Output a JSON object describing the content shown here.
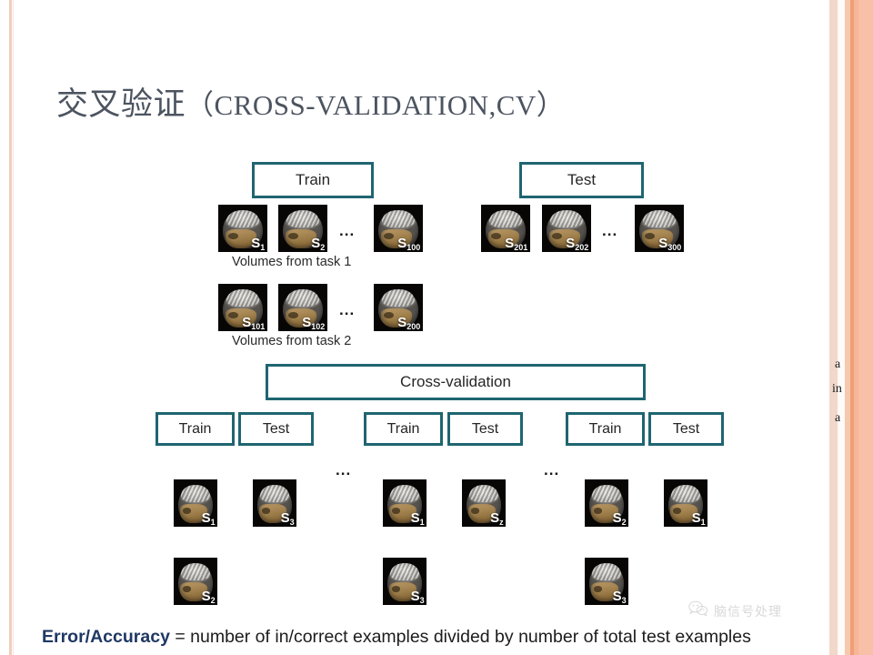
{
  "slide": {
    "title_cn": "交叉验证",
    "title_en": "（CROSS-VALIDATION,CV）"
  },
  "top_section": {
    "train_box": "Train",
    "test_box": "Test",
    "task1_caption": "Volumes from task 1",
    "task2_caption": "Volumes from task 2",
    "ellipsis": "...",
    "train_task1_brains": [
      {
        "label": "S",
        "sub": "1"
      },
      {
        "label": "S",
        "sub": "2"
      },
      {
        "label": "S",
        "sub": "100"
      }
    ],
    "test_brains": [
      {
        "label": "S",
        "sub": "201"
      },
      {
        "label": "S",
        "sub": "202"
      },
      {
        "label": "S",
        "sub": "300"
      }
    ],
    "task2_brains": [
      {
        "label": "S",
        "sub": "101"
      },
      {
        "label": "S",
        "sub": "102"
      },
      {
        "label": "S",
        "sub": "200"
      }
    ]
  },
  "cv_section": {
    "cv_box": "Cross-validation",
    "ellipsis": "...",
    "folds": [
      {
        "train_label": "Train",
        "test_label": "Test",
        "row1": [
          {
            "label": "S",
            "sub": "1"
          },
          {
            "label": "S",
            "sub": "3"
          }
        ],
        "row2": [
          {
            "label": "S",
            "sub": "2"
          }
        ]
      },
      {
        "train_label": "Train",
        "test_label": "Test",
        "row1": [
          {
            "label": "S",
            "sub": "1"
          },
          {
            "label": "S",
            "sub": "z"
          }
        ],
        "row2": [
          {
            "label": "S",
            "sub": "3"
          }
        ]
      },
      {
        "train_label": "Train",
        "test_label": "Test",
        "row1": [
          {
            "label": "S",
            "sub": "2"
          },
          {
            "label": "S",
            "sub": "1"
          }
        ],
        "row2": [
          {
            "label": "S",
            "sub": "3"
          }
        ]
      }
    ]
  },
  "footer": {
    "bold_prefix": "Error/Accuracy",
    "rest": " = number of in/correct examples divided by number of total test examples"
  },
  "watermark": {
    "text": "脑信号处理",
    "icon": "wechat-icon"
  },
  "right_margin_text": {
    "line1": "a",
    "line2": "in",
    "line3": "a"
  },
  "colors": {
    "box_border": "#1f6571",
    "title_text": "#4c5460",
    "footer_accent": "#1f3864",
    "edge_salmon": "#f4b79a",
    "edge_light": "#f7d4c4"
  }
}
